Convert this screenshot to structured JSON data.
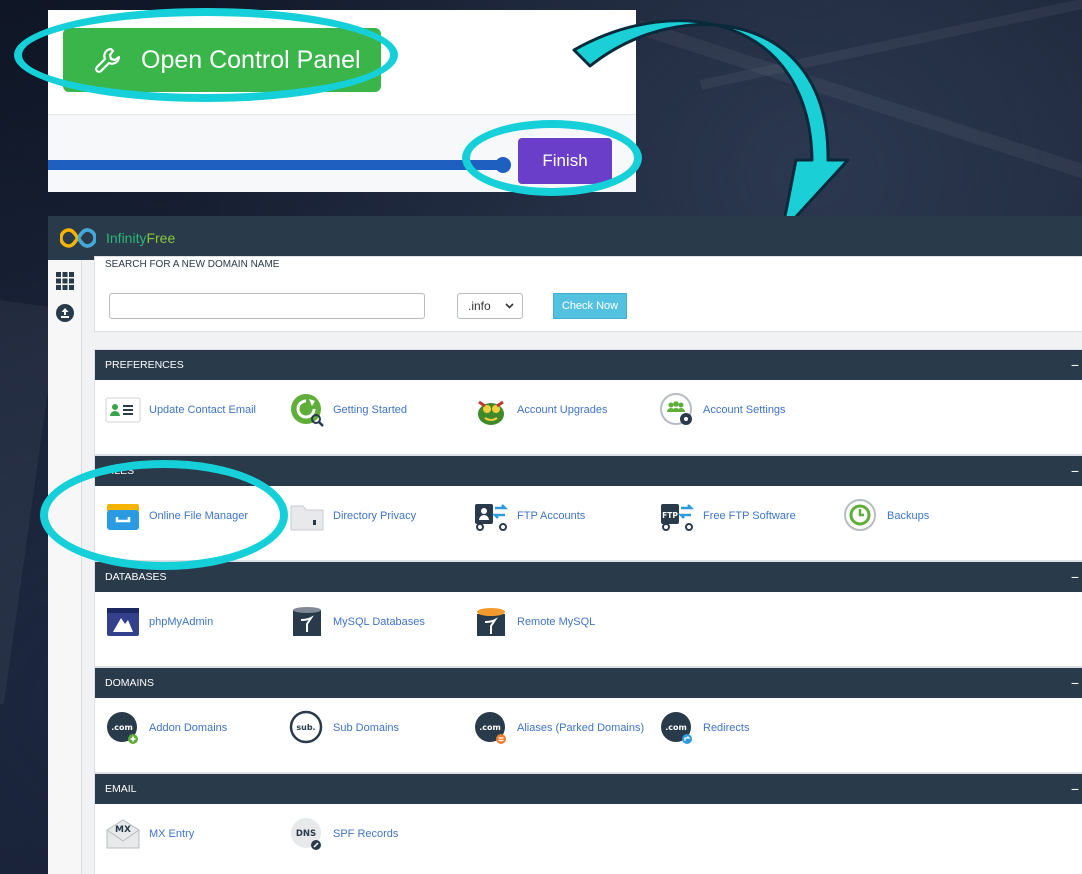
{
  "top_card": {
    "open_control_panel_label": "Open Control Panel",
    "finish_label": "Finish",
    "progress": 0.78
  },
  "cpanel": {
    "brand": {
      "part1": "Infinity",
      "part2": "Free"
    },
    "sidebar": [
      "grid-icon",
      "upload-icon"
    ],
    "domain_search": {
      "title": "SEARCH FOR A NEW DOMAIN NAME",
      "input_value": "",
      "tld_selected": ".info",
      "check_button": "Check Now"
    },
    "groups": [
      {
        "key": "preferences",
        "title": "PREFERENCES",
        "items": [
          {
            "label": "Update Contact Email",
            "icon": "contact-card-icon"
          },
          {
            "label": "Getting Started",
            "icon": "getting-started-icon"
          },
          {
            "label": "Account Upgrades",
            "icon": "dragon-icon"
          },
          {
            "label": "Account Settings",
            "icon": "account-settings-icon"
          }
        ]
      },
      {
        "key": "files",
        "title": "FILES",
        "items": [
          {
            "label": "Online File Manager",
            "icon": "file-manager-icon"
          },
          {
            "label": "Directory Privacy",
            "icon": "folder-lock-icon"
          },
          {
            "label": "FTP Accounts",
            "icon": "ftp-accounts-icon"
          },
          {
            "label": "Free FTP Software",
            "icon": "ftp-software-icon"
          },
          {
            "label": "Backups",
            "icon": "backup-icon"
          }
        ]
      },
      {
        "key": "databases",
        "title": "DATABASES",
        "items": [
          {
            "label": "phpMyAdmin",
            "icon": "phpmyadmin-icon"
          },
          {
            "label": "MySQL Databases",
            "icon": "mysql-database-icon"
          },
          {
            "label": "Remote MySQL",
            "icon": "remote-mysql-icon"
          }
        ]
      },
      {
        "key": "domains",
        "title": "DOMAINS",
        "items": [
          {
            "label": "Addon Domains",
            "icon": "addon-domain-icon",
            "badge": ".com"
          },
          {
            "label": "Sub Domains",
            "icon": "subdomain-icon",
            "badge": "sub."
          },
          {
            "label": "Aliases (Parked Domains)",
            "icon": "alias-domain-icon",
            "badge": ".com"
          },
          {
            "label": "Redirects",
            "icon": "redirect-domain-icon",
            "badge": ".com"
          }
        ]
      },
      {
        "key": "email",
        "title": "EMAIL",
        "items": [
          {
            "label": "MX Entry",
            "icon": "mx-entry-icon",
            "badge": "MX"
          },
          {
            "label": "SPF Records",
            "icon": "spf-records-icon",
            "badge": "DNS"
          }
        ]
      }
    ],
    "collapse_glyph": "−"
  },
  "colors": {
    "cpanel_header": "#293a4a",
    "link": "#3f74c4",
    "green_button": "#3ab54a",
    "finish_button": "#6a3ec8",
    "highlight_ring": "#15d0d8",
    "progress": "#1f5fbf",
    "check_button": "#55c1e0"
  }
}
